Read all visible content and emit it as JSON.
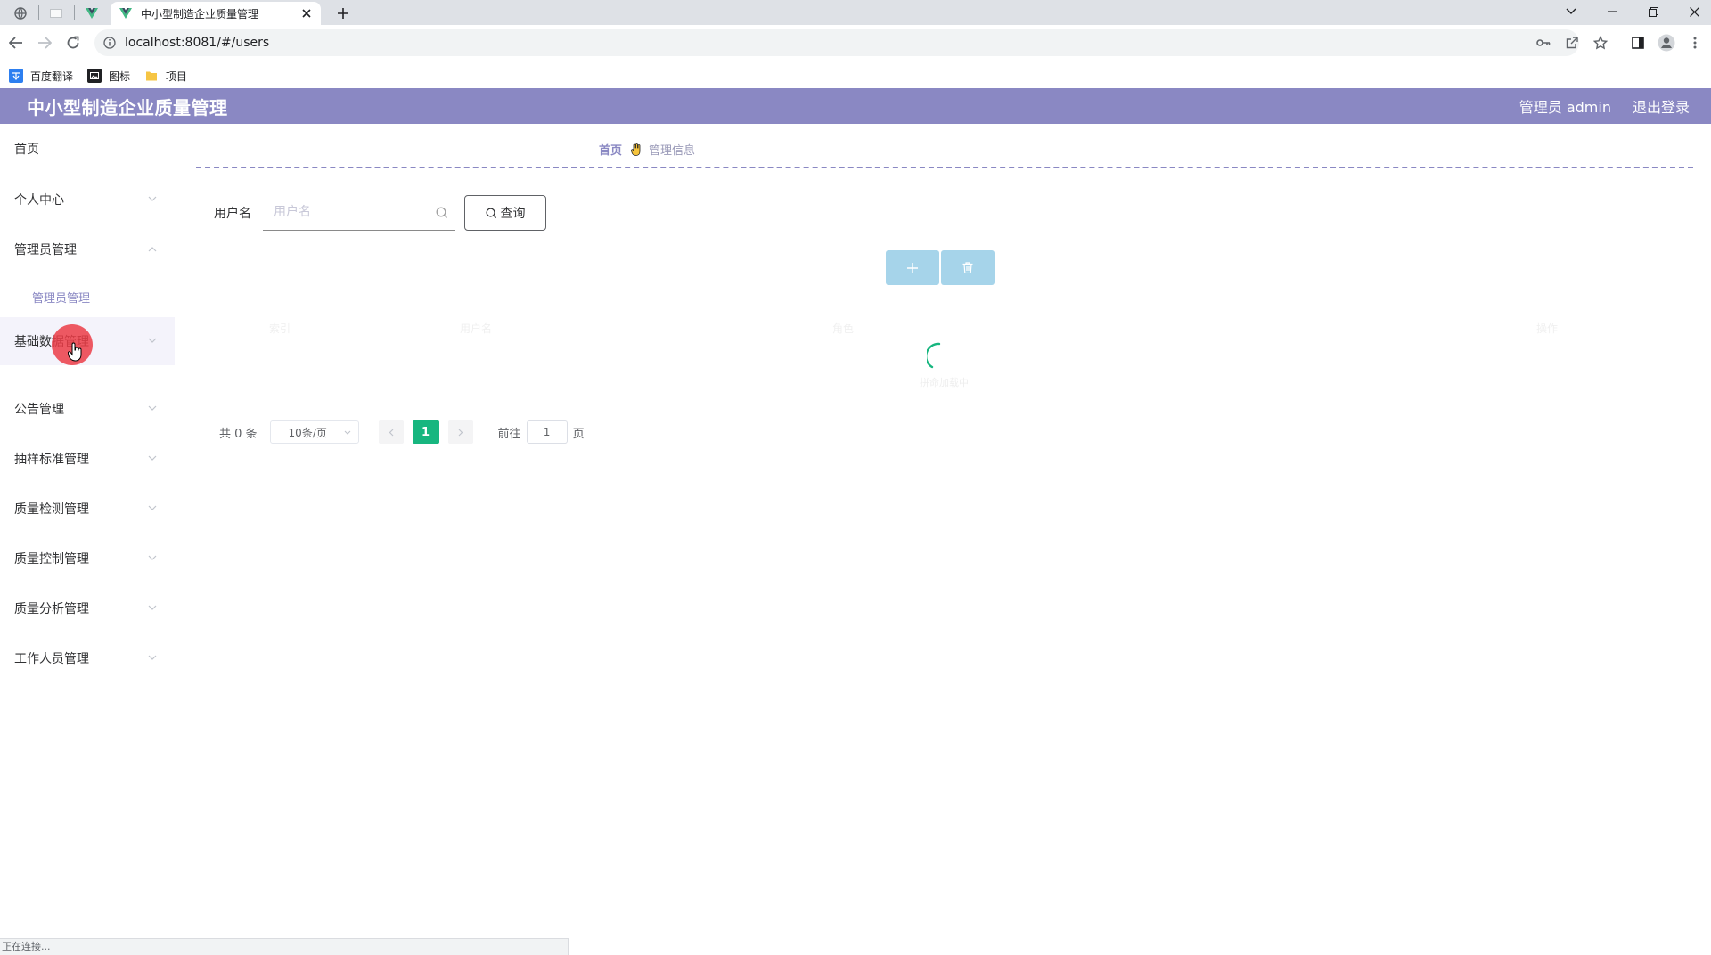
{
  "browser": {
    "tab_title": "中小型制造企业质量管理",
    "url": "localhost:8081/#/users",
    "bookmarks": [
      {
        "label": "百度翻译",
        "icon": "translate-icon"
      },
      {
        "label": "图标",
        "icon": "image-icon"
      },
      {
        "label": "项目",
        "icon": "folder-icon"
      }
    ],
    "status_text": "正在连接..."
  },
  "header": {
    "title": "中小型制造企业质量管理",
    "user_label": "管理员 admin",
    "logout_label": "退出登录"
  },
  "sidebar": {
    "items": [
      {
        "label": "首页",
        "arrow": "none"
      },
      {
        "label": "个人中心",
        "arrow": "down"
      },
      {
        "label": "管理员管理",
        "arrow": "up"
      },
      {
        "label": "管理员管理",
        "arrow": "none",
        "sub": true
      },
      {
        "label": "基础数据管理",
        "arrow": "down"
      },
      {
        "label": "公告管理",
        "arrow": "down"
      },
      {
        "label": "抽样标准管理",
        "arrow": "down"
      },
      {
        "label": "质量检测管理",
        "arrow": "down"
      },
      {
        "label": "质量控制管理",
        "arrow": "down"
      },
      {
        "label": "质量分析管理",
        "arrow": "down"
      },
      {
        "label": "工作人员管理",
        "arrow": "down"
      }
    ]
  },
  "breadcrumb": {
    "home": "首页",
    "current": "管理信息"
  },
  "search": {
    "label": "用户名",
    "placeholder": "用户名",
    "button_label": "查询"
  },
  "table": {
    "columns": [
      "索引",
      "用户名",
      "角色",
      "操作"
    ],
    "loading_text": "拼命加载中"
  },
  "pagination": {
    "total_text": "共 0 条",
    "page_size": "10条/页",
    "current_page": "1",
    "goto_prefix": "前往",
    "goto_value": "1",
    "goto_suffix": "页"
  },
  "colors": {
    "theme": "#8a88c3",
    "action_button": "#a6d4ea",
    "page_active": "#17b67f"
  }
}
